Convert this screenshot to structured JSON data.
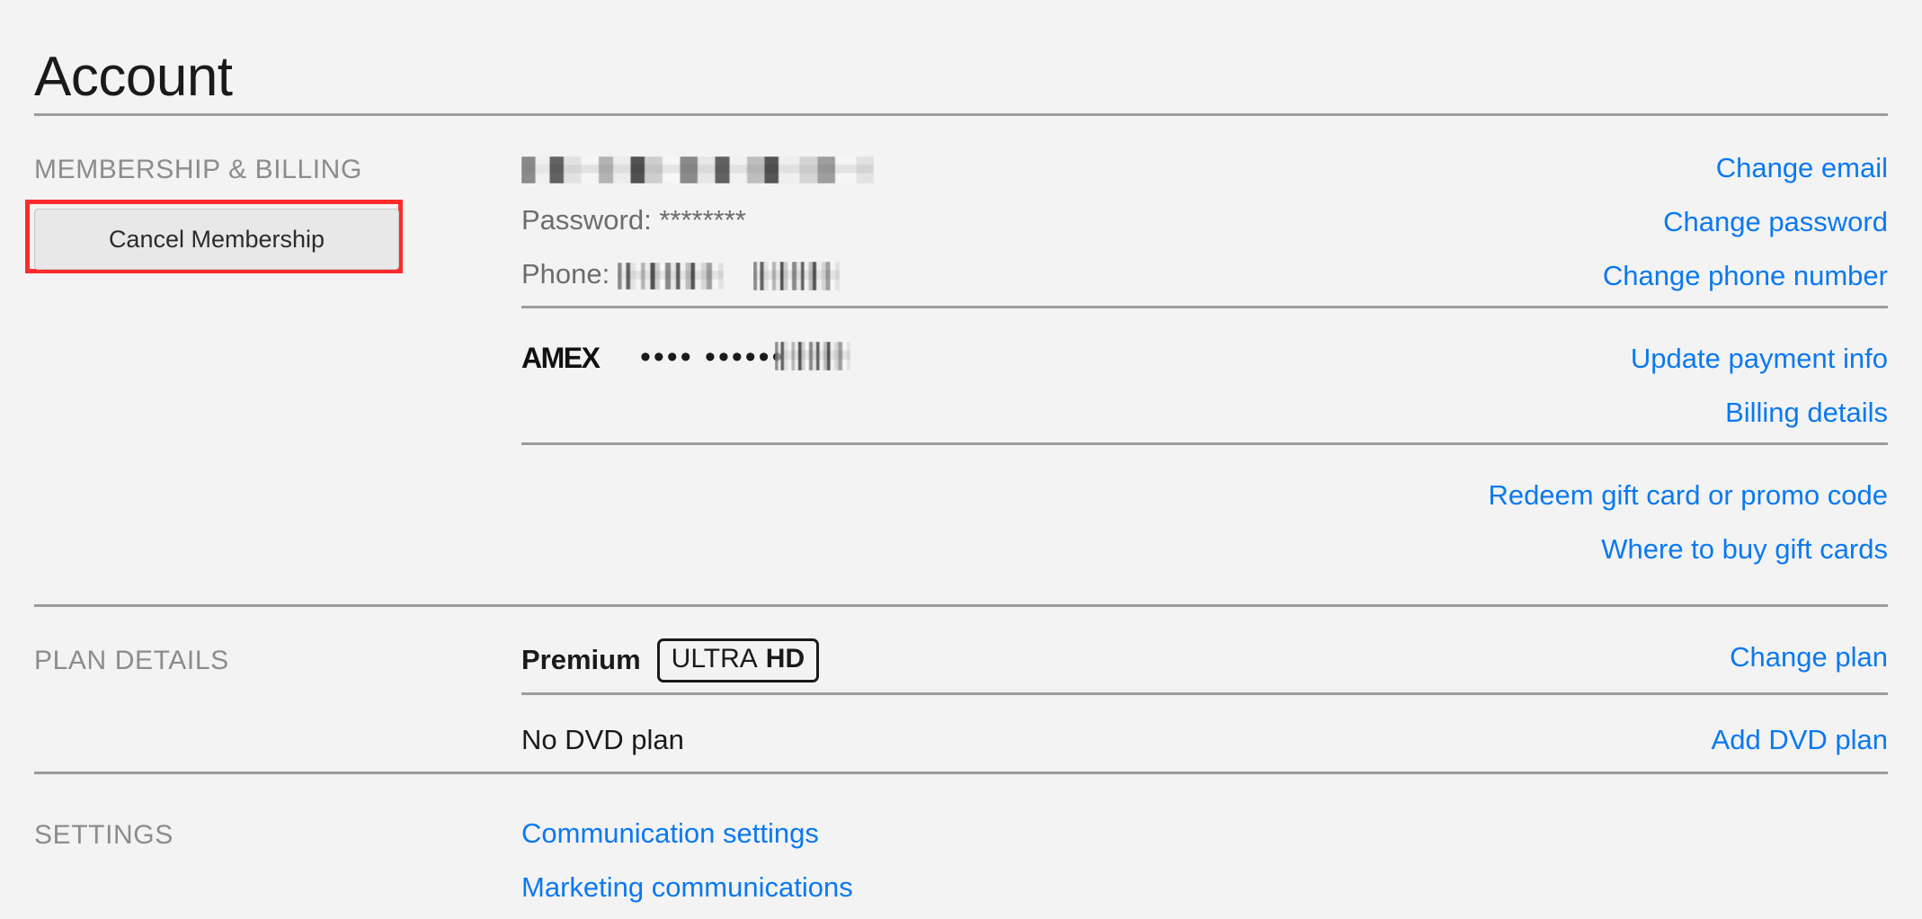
{
  "page": {
    "title": "Account",
    "background_color": "#f3f3f3",
    "link_color": "#0b79f0",
    "label_color": "#8c8c8c",
    "highlight_color": "#ff2b2b"
  },
  "membership": {
    "section_label": "MEMBERSHIP & BILLING",
    "cancel_button_label": "Cancel Membership",
    "email_value": "",
    "password_label": "Password:",
    "password_value": "********",
    "phone_label": "Phone:",
    "card_brand": "AMEX",
    "card_dots": "•••• ••••••",
    "links": {
      "change_email": "Change email",
      "change_password": "Change password",
      "change_phone_number": "Change phone number",
      "update_payment_info": "Update payment info",
      "billing_details": "Billing details",
      "redeem_gift_card": "Redeem gift card or promo code",
      "where_to_buy_gift_cards": "Where to buy gift cards"
    }
  },
  "plan_details": {
    "section_label": "PLAN DETAILS",
    "plan_name": "Premium",
    "badge_primary": "ULTRA",
    "badge_secondary": "HD",
    "dvd_plan": "No DVD plan",
    "links": {
      "change_plan": "Change plan",
      "add_dvd_plan": "Add DVD plan"
    }
  },
  "settings": {
    "section_label": "SETTINGS",
    "links": {
      "communication_settings": "Communication settings",
      "marketing_communications": "Marketing communications"
    }
  }
}
